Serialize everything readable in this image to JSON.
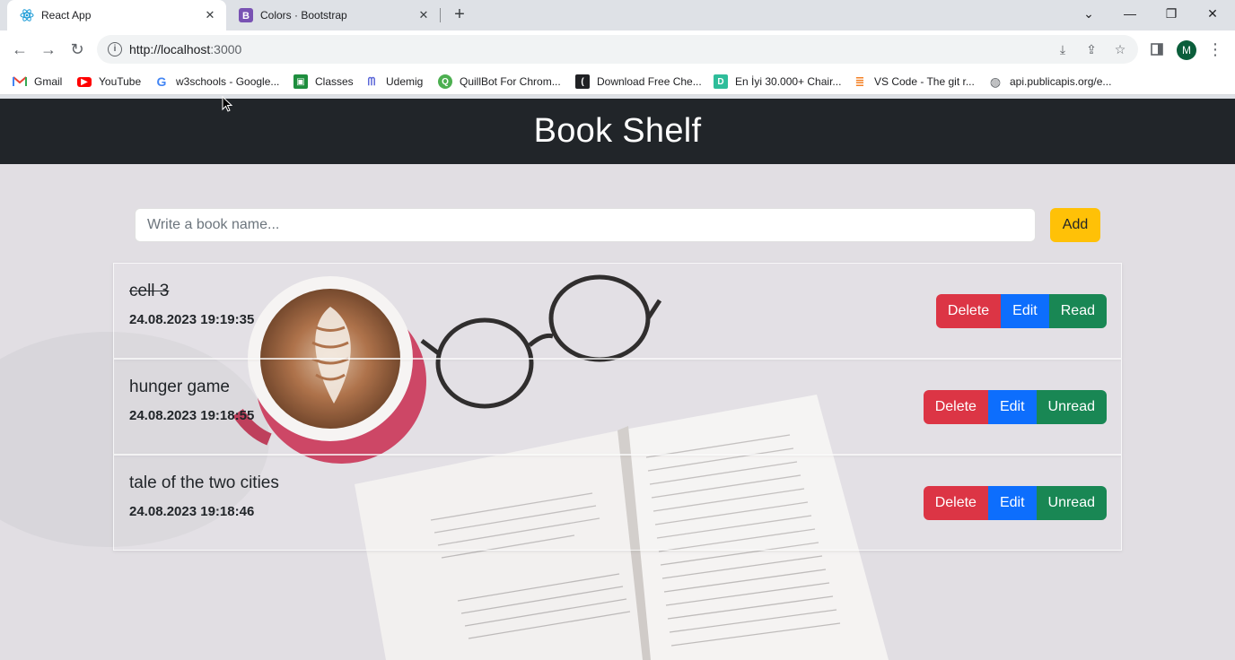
{
  "browser": {
    "tabs": [
      {
        "title": "React App",
        "icon": "react-icon"
      },
      {
        "title": "Colors · Bootstrap",
        "icon": "bootstrap-icon"
      }
    ],
    "url_host": "http://localhost",
    "url_port": ":3000",
    "profile_initial": "M",
    "bookmarks": [
      {
        "label": "Gmail",
        "icon": "gmail-icon",
        "color": "#ea4335"
      },
      {
        "label": "YouTube",
        "icon": "youtube-icon",
        "color": "#ff0000"
      },
      {
        "label": "w3schools - Google...",
        "icon": "google-icon",
        "color": "#4285f4"
      },
      {
        "label": "Classes",
        "icon": "classroom-icon",
        "color": "#1e8e3e"
      },
      {
        "label": "Udemig",
        "icon": "udemig-icon",
        "color": "#5b67d8"
      },
      {
        "label": "QuillBot For Chrom...",
        "icon": "quillbot-icon",
        "color": "#4caf50"
      },
      {
        "label": "Download Free Che...",
        "icon": "cheatsheet-icon",
        "color": "#202124"
      },
      {
        "label": "En İyi 30.000+ Chair...",
        "icon": "d-icon",
        "color": "#2ebd9a"
      },
      {
        "label": "VS Code - The git r...",
        "icon": "stack-icon",
        "color": "#f48024"
      },
      {
        "label": "api.publicapis.org/e...",
        "icon": "globe-icon",
        "color": "#5f6368"
      }
    ]
  },
  "app": {
    "title": "Book Shelf",
    "input_placeholder": "Write a book name...",
    "add_label": "Add",
    "books": [
      {
        "name": "cell 3",
        "date": "24.08.2023 19:19:35",
        "read": true,
        "delete_label": "Delete",
        "edit_label": "Edit",
        "toggle_label": "Read"
      },
      {
        "name": "hunger game",
        "date": "24.08.2023 19:18:55",
        "read": false,
        "delete_label": "Delete",
        "edit_label": "Edit",
        "toggle_label": "Unread"
      },
      {
        "name": "tale of the two cities",
        "date": "24.08.2023 19:18:46",
        "read": false,
        "delete_label": "Delete",
        "edit_label": "Edit",
        "toggle_label": "Unread"
      }
    ],
    "colors": {
      "header_bg": "#212529",
      "add": "#ffc107",
      "delete": "#dc3545",
      "edit": "#0d6efd",
      "toggle": "#198754"
    }
  }
}
